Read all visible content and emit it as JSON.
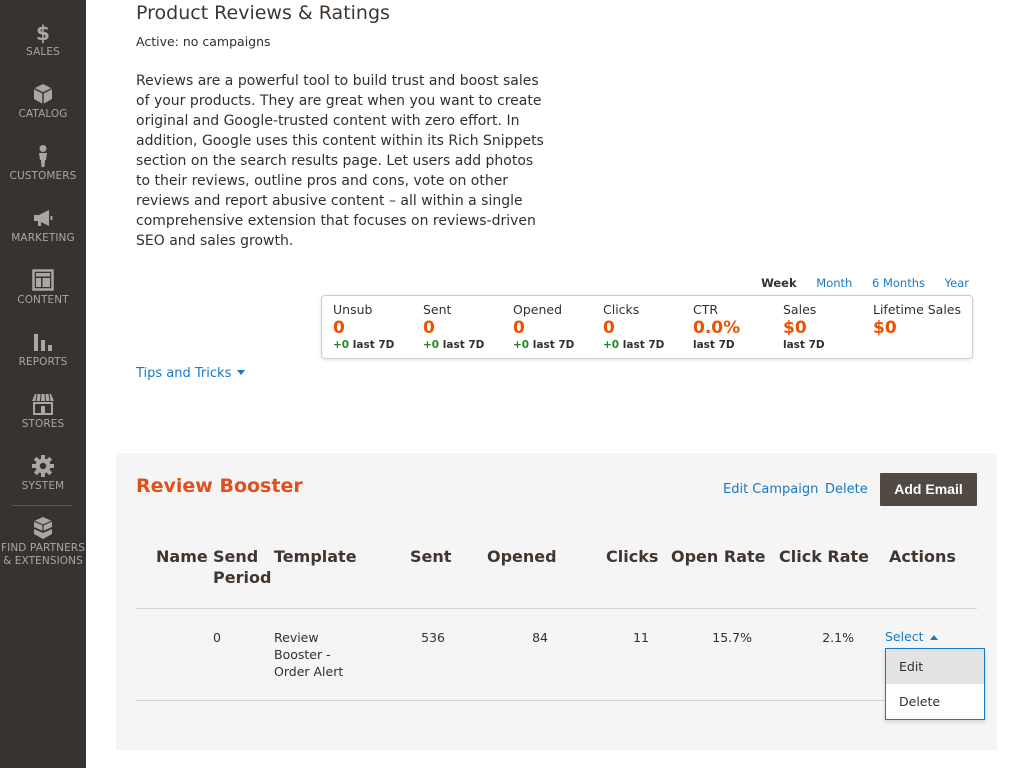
{
  "sidebar": {
    "items": [
      {
        "label": "SALES",
        "icon": "dollar-icon"
      },
      {
        "label": "CATALOG",
        "icon": "cube-icon"
      },
      {
        "label": "CUSTOMERS",
        "icon": "person-icon"
      },
      {
        "label": "MARKETING",
        "icon": "megaphone-icon"
      },
      {
        "label": "CONTENT",
        "icon": "layout-icon"
      },
      {
        "label": "REPORTS",
        "icon": "bar-chart-icon"
      },
      {
        "label": "STORES",
        "icon": "storefront-icon"
      },
      {
        "label": "SYSTEM",
        "icon": "gear-icon"
      },
      {
        "label_line1": "FIND PARTNERS",
        "label_line2": "& EXTENSIONS",
        "icon": "boxes-icon"
      }
    ]
  },
  "header": {
    "title": "Product Reviews & Ratings",
    "status": "Active: no campaigns",
    "description": "Reviews are a powerful tool to build trust and boost sales of your products. They are great when you want to create original and Google-trusted content with zero effort. In addition, Google uses this content within its Rich Snippets section on the search results page. Let users add photos to their reviews, outline pros and cons, vote on other reviews and report abusive content – all within a single comprehensive extension that focuses on reviews-driven SEO and sales growth."
  },
  "periods": {
    "week": "Week",
    "month": "Month",
    "six_months": "6 Months",
    "year": "Year",
    "active": "Week"
  },
  "stats": [
    {
      "label": "Unsub",
      "value": "0",
      "delta": "+0",
      "period": "last 7D"
    },
    {
      "label": "Sent",
      "value": "0",
      "delta": "+0",
      "period": "last 7D"
    },
    {
      "label": "Opened",
      "value": "0",
      "delta": "+0",
      "period": "last 7D"
    },
    {
      "label": "Clicks",
      "value": "0",
      "delta": "+0",
      "period": "last 7D"
    },
    {
      "label": "CTR",
      "value": "0.0%",
      "delta": "",
      "period": "last 7D"
    },
    {
      "label": "Sales",
      "value": "$0",
      "delta": "",
      "period": "last 7D"
    },
    {
      "label": "Lifetime Sales",
      "value": "$0",
      "delta": "",
      "period": ""
    }
  ],
  "tips": "Tips and Tricks",
  "campaign": {
    "title": "Review Booster",
    "edit_label": "Edit Campaign",
    "delete_label": "Delete",
    "add_email_label": "Add Email",
    "columns": {
      "name": "Name",
      "send_period_1": "Send",
      "send_period_2": "Period",
      "template": "Template",
      "sent": "Sent",
      "opened": "Opened",
      "clicks": "Clicks",
      "open_rate": "Open Rate",
      "click_rate": "Click Rate",
      "actions": "Actions"
    },
    "rows": [
      {
        "name": "",
        "send_period": "0",
        "template_1": "Review",
        "template_2": "Booster -",
        "template_3": "Order Alert",
        "sent": "536",
        "opened": "84",
        "clicks": "11",
        "open_rate": "15.7%",
        "click_rate": "2.1%",
        "action": "Select"
      }
    ],
    "dropdown": [
      "Edit",
      "Delete"
    ]
  },
  "colors": {
    "accent": "#eb5202",
    "link": "#1979c3",
    "sidebar": "#373330",
    "positive": "#1e8a25"
  }
}
